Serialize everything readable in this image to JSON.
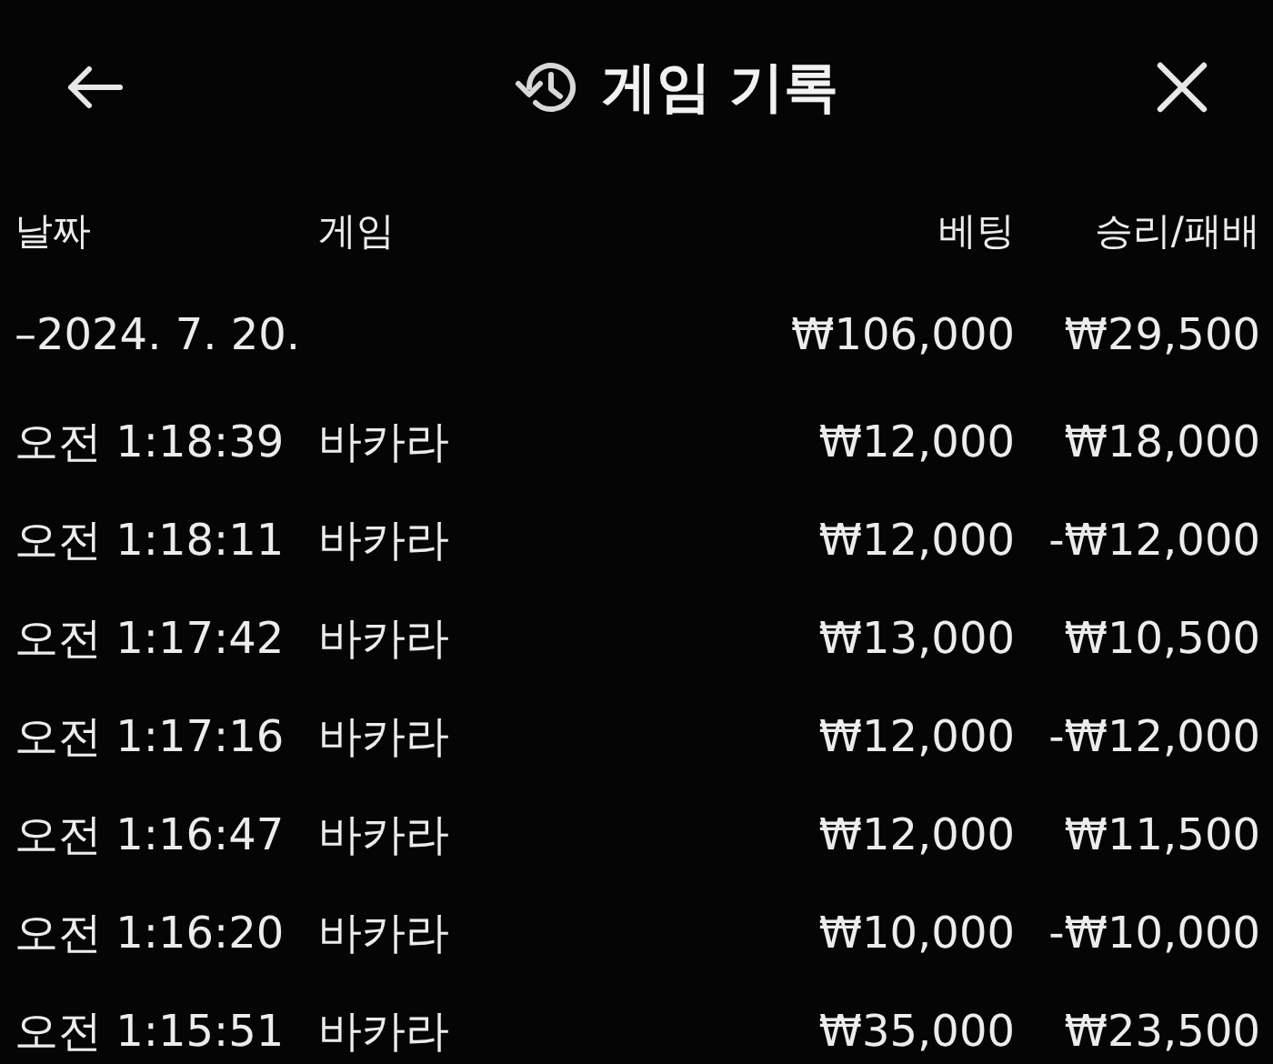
{
  "header": {
    "title": "게임 기록"
  },
  "table": {
    "columns": [
      "날짜",
      "게임",
      "베팅",
      "승리/패배"
    ],
    "group": {
      "label": "–2024. 7. 20.",
      "bet": "₩106,000",
      "result": "₩29,500"
    },
    "rows": [
      {
        "time": "오전 1:18:39",
        "game": "바카라",
        "bet": "₩12,000",
        "result": "₩18,000"
      },
      {
        "time": "오전 1:18:11",
        "game": "바카라",
        "bet": "₩12,000",
        "result": "-₩12,000"
      },
      {
        "time": "오전 1:17:42",
        "game": "바카라",
        "bet": "₩13,000",
        "result": "₩10,500"
      },
      {
        "time": "오전 1:17:16",
        "game": "바카라",
        "bet": "₩12,000",
        "result": "-₩12,000"
      },
      {
        "time": "오전 1:16:47",
        "game": "바카라",
        "bet": "₩12,000",
        "result": "₩11,500"
      },
      {
        "time": "오전 1:16:20",
        "game": "바카라",
        "bet": "₩10,000",
        "result": "-₩10,000"
      },
      {
        "time": "오전 1:15:51",
        "game": "바카라",
        "bet": "₩35,000",
        "result": "₩23,500"
      }
    ]
  }
}
